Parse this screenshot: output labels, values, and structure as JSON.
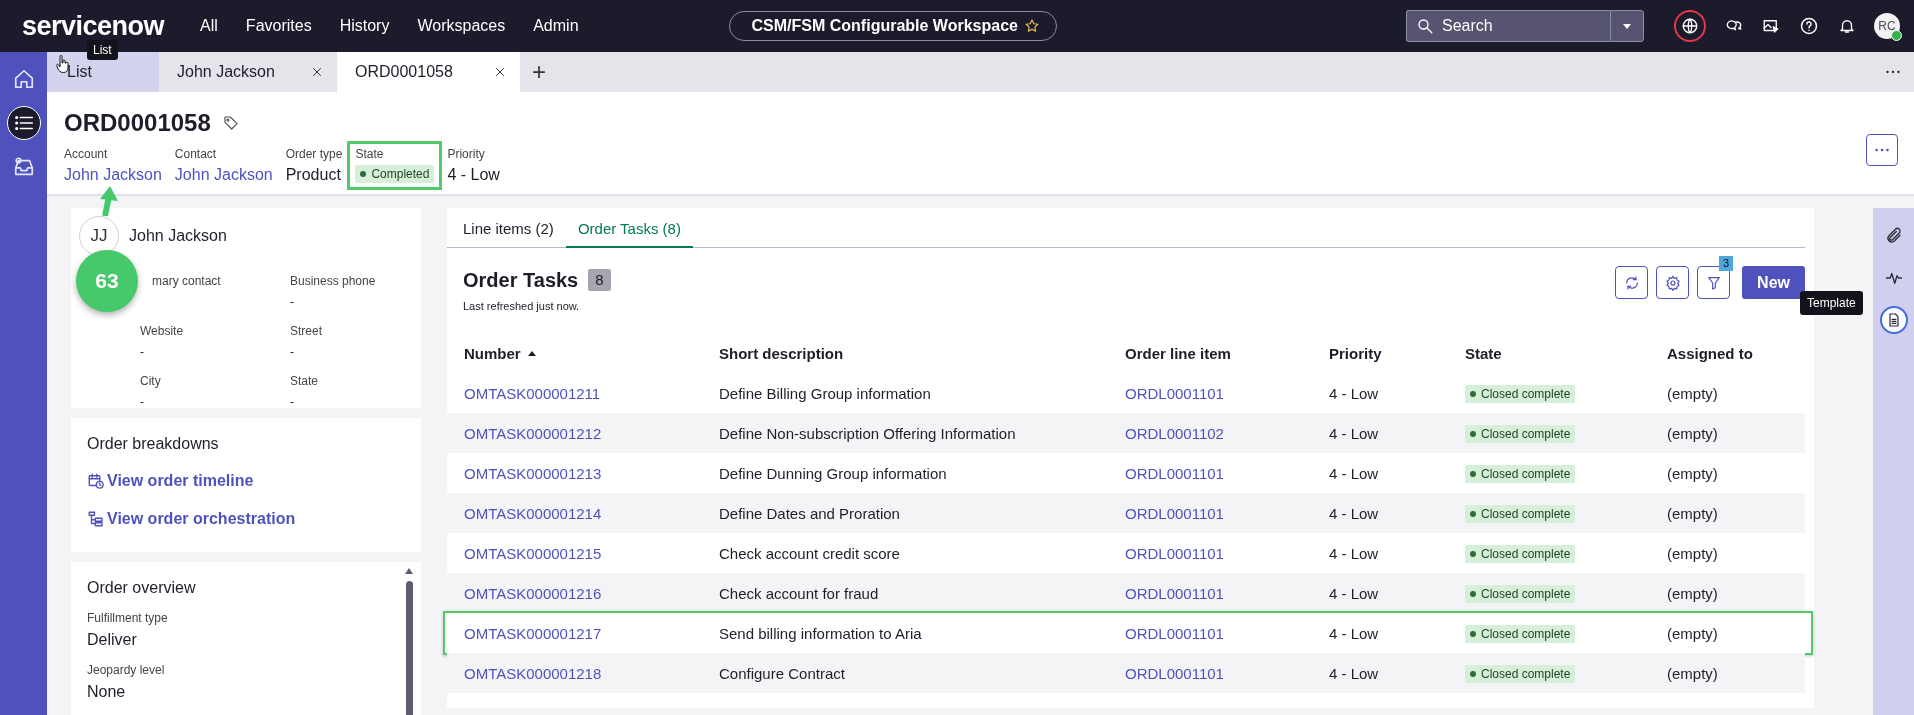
{
  "topbar": {
    "logo": "servicenow",
    "logo_tooltip": "List",
    "nav": [
      "All",
      "Favorites",
      "History",
      "Workspaces",
      "Admin"
    ],
    "workspace": "CSM/FSM Configurable Workspace",
    "search": {
      "placeholder": "Search"
    },
    "avatar": "RC"
  },
  "rail": [
    {
      "kind": "home",
      "selected": false
    },
    {
      "kind": "list",
      "selected": true
    },
    {
      "kind": "inbox",
      "selected": false
    }
  ],
  "tabs": [
    {
      "label": "List",
      "selected": false,
      "closable": false
    },
    {
      "label": "John Jackson",
      "selected": false,
      "closable": true
    },
    {
      "label": "ORD0001058",
      "selected": true,
      "closable": true
    }
  ],
  "add_tab": "+",
  "record": {
    "title": "ORD0001058",
    "fields": [
      {
        "label": "Account",
        "value": "John Jackson",
        "kind": "link",
        "highlighted": false
      },
      {
        "label": "Contact",
        "value": "John Jackson",
        "kind": "link",
        "highlighted": false
      },
      {
        "label": "Order type",
        "value": "Product",
        "kind": "text",
        "highlighted": false
      },
      {
        "label": "State",
        "value": "Completed",
        "kind": "status",
        "highlighted": true
      },
      {
        "label": "Priority",
        "value": "4 - Low",
        "kind": "text",
        "highlighted": false
      }
    ]
  },
  "contact_card": {
    "initials": "JJ",
    "name": "John Jackson",
    "fields": [
      {
        "label": "mary contact"
      },
      {
        "label": "Business phone",
        "value": "-"
      },
      {
        "label": "Website",
        "value": "-"
      },
      {
        "label": "Street",
        "value": "-"
      },
      {
        "label": "City",
        "value": "-"
      },
      {
        "label": "State",
        "value": "-"
      }
    ]
  },
  "breakdowns": {
    "title": "Order breakdowns",
    "links": [
      {
        "kind": "timeline",
        "label": "View order timeline"
      },
      {
        "kind": "orchestration",
        "label": "View order orchestration"
      }
    ]
  },
  "overview": {
    "title": "Order overview",
    "fields": [
      {
        "label": "Fulfillment type",
        "value": "Deliver"
      },
      {
        "label": "Jeopardy level",
        "value": "None"
      }
    ]
  },
  "related_tabs": [
    {
      "label": "Line items (2)",
      "selected": false
    },
    {
      "label": "Order Tasks (8)",
      "selected": true
    }
  ],
  "list": {
    "title": "Order Tasks",
    "count": "8",
    "refreshed": "Last refreshed just now.",
    "filter_count": "3",
    "new_button": "New",
    "columns": [
      {
        "label": "Number",
        "sorted": true
      },
      {
        "label": "Short description",
        "sorted": false
      },
      {
        "label": "Order line item",
        "sorted": false
      },
      {
        "label": "Priority",
        "sorted": false
      },
      {
        "label": "State",
        "sorted": false
      },
      {
        "label": "Assigned to",
        "sorted": false
      }
    ],
    "rows": [
      {
        "number": "OMTASK000001211",
        "description": "Define Billing Group information",
        "line_item": "ORDL0001101",
        "priority": "4 - Low",
        "state": "Closed complete",
        "assigned_to": "(empty)",
        "highlighted": false
      },
      {
        "number": "OMTASK000001212",
        "description": "Define Non-subscription Offering Information",
        "line_item": "ORDL0001102",
        "priority": "4 - Low",
        "state": "Closed complete",
        "assigned_to": "(empty)",
        "highlighted": false
      },
      {
        "number": "OMTASK000001213",
        "description": "Define Dunning Group information",
        "line_item": "ORDL0001101",
        "priority": "4 - Low",
        "state": "Closed complete",
        "assigned_to": "(empty)",
        "highlighted": false
      },
      {
        "number": "OMTASK000001214",
        "description": "Define Dates and Proration",
        "line_item": "ORDL0001101",
        "priority": "4 - Low",
        "state": "Closed complete",
        "assigned_to": "(empty)",
        "highlighted": false
      },
      {
        "number": "OMTASK000001215",
        "description": "Check account credit score",
        "line_item": "ORDL0001101",
        "priority": "4 - Low",
        "state": "Closed complete",
        "assigned_to": "(empty)",
        "highlighted": false
      },
      {
        "number": "OMTASK000001216",
        "description": "Check account for fraud",
        "line_item": "ORDL0001101",
        "priority": "4 - Low",
        "state": "Closed complete",
        "assigned_to": "(empty)",
        "highlighted": false
      },
      {
        "number": "OMTASK000001217",
        "description": "Send billing information to Aria",
        "line_item": "ORDL0001101",
        "priority": "4 - Low",
        "state": "Closed complete",
        "assigned_to": "(empty)",
        "highlighted": true
      },
      {
        "number": "OMTASK000001218",
        "description": "Configure Contract",
        "line_item": "ORDL0001101",
        "priority": "4 - Low",
        "state": "Closed complete",
        "assigned_to": "(empty)",
        "highlighted": false
      }
    ]
  },
  "right_rail": [
    {
      "kind": "attachment",
      "selected": false
    },
    {
      "kind": "activity",
      "selected": false
    },
    {
      "kind": "template",
      "selected": true
    }
  ],
  "tooltip": "Template",
  "annotation": {
    "step": "63"
  }
}
